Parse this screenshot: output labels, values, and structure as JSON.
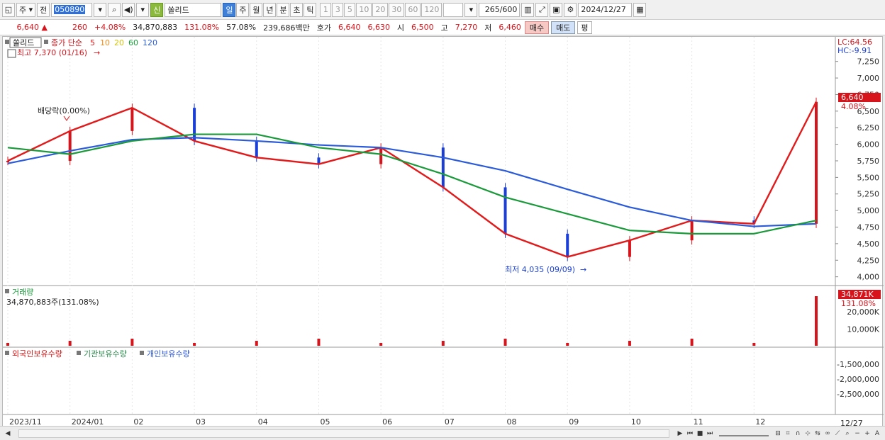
{
  "toolbar": {
    "market": "주",
    "period_prefix": "전",
    "code": "050890",
    "badge": "신",
    "stock_name": "쏠리드",
    "periods": [
      "일",
      "주",
      "월",
      "년",
      "분",
      "초",
      "틱"
    ],
    "active_period": "일",
    "minute_options": [
      "1",
      "3",
      "5",
      "10",
      "20",
      "30",
      "60",
      "120"
    ],
    "count_display": "265",
    "count_max": "/600",
    "date": "2024/12/27"
  },
  "quote": {
    "price": "6,640",
    "arrow": "▲",
    "change": "260",
    "change_pct": "+4.08%",
    "volume": "34,870,883",
    "volume_ratio": "131.08%",
    "turnover": "57.08%",
    "amount": "239,686백만",
    "ask_label": "호가",
    "ask1": "6,640",
    "ask2": "6,630",
    "open_label": "시",
    "open": "6,500",
    "high_label": "고",
    "high": "7,270",
    "low_label": "저",
    "low": "6,460",
    "buy": "매수",
    "sell": "매도",
    "eval": "평"
  },
  "price_panel": {
    "name": "쏠리드",
    "legend_title": "종가 단순",
    "ma_periods": [
      "5",
      "10",
      "20",
      "60",
      "120"
    ],
    "high_marker": "최고 7,370 (01/16)",
    "low_marker": "최저 4,035 (09/09)",
    "dividend_marker": "배당락(0.00%)",
    "lc": "LC:64.56",
    "hc": "HC:-9.91",
    "last_price": "6,640",
    "last_pct": "4.08%",
    "y_ticks": [
      "7,250",
      "7,000",
      "6,750",
      "6,500",
      "6,250",
      "6,000",
      "5,750",
      "5,500",
      "5,250",
      "5,000",
      "4,750",
      "4,500",
      "4,250",
      "4,000"
    ]
  },
  "volume_panel": {
    "name": "거래량",
    "current": "34,870,883주(131.08%)",
    "last_label": "34,871K",
    "last_pct": "131.08%",
    "y_ticks": [
      "20,000K",
      "10,000K"
    ]
  },
  "holdings_panel": {
    "legend": [
      "외국인보유수량",
      "기관보유수량",
      "개인보유수량"
    ],
    "y_ticks": [
      "-1,500,000",
      "-2,000,000",
      "-2,500,000"
    ]
  },
  "x_axis": {
    "labels": [
      "2023/11",
      "2024/01",
      "02",
      "03",
      "04",
      "05",
      "06",
      "07",
      "08",
      "09",
      "10",
      "11",
      "12"
    ],
    "current_label": "12/27"
  },
  "colors": {
    "up": "#d7141b",
    "down": "#1b3fd6",
    "ma5": "#e11b1b",
    "ma10": "#f28c1e",
    "ma20": "#f5e21c",
    "ma60": "#1a9a3a",
    "ma120": "#2b5bd8",
    "foreign": "#d01616",
    "institution": "#2b8a4e",
    "individual": "#2b55d6"
  },
  "chart_data": {
    "type": "line",
    "title": "쏠리드",
    "x_unit": "month",
    "series": [
      {
        "name": "종가",
        "months": [
          "2023/11",
          "2024/01",
          "02",
          "03",
          "04",
          "05",
          "06",
          "07",
          "08",
          "09",
          "10",
          "11",
          "12",
          "12/27"
        ],
        "values": [
          5750,
          6200,
          6550,
          6050,
          5800,
          5700,
          5950,
          5350,
          4650,
          4300,
          4550,
          4850,
          4800,
          6640
        ]
      },
      {
        "name": "120",
        "months": [
          "2023/11",
          "2024/01",
          "02",
          "03",
          "04",
          "05",
          "06",
          "07",
          "08",
          "09",
          "10",
          "11",
          "12",
          "12/27"
        ],
        "values": [
          5710,
          5900,
          6070,
          6100,
          6050,
          5990,
          5950,
          5800,
          5600,
          5320,
          5050,
          4850,
          4760,
          4800
        ]
      },
      {
        "name": "60",
        "months": [
          "2023/11",
          "2024/01",
          "02",
          "03",
          "04",
          "05",
          "06",
          "07",
          "08",
          "09",
          "10",
          "11",
          "12",
          "12/27"
        ],
        "values": [
          5950,
          5850,
          6050,
          6150,
          6150,
          5950,
          5850,
          5550,
          5200,
          4950,
          4700,
          4650,
          4650,
          4850
        ]
      }
    ],
    "ylim": [
      3900,
      7450
    ]
  }
}
